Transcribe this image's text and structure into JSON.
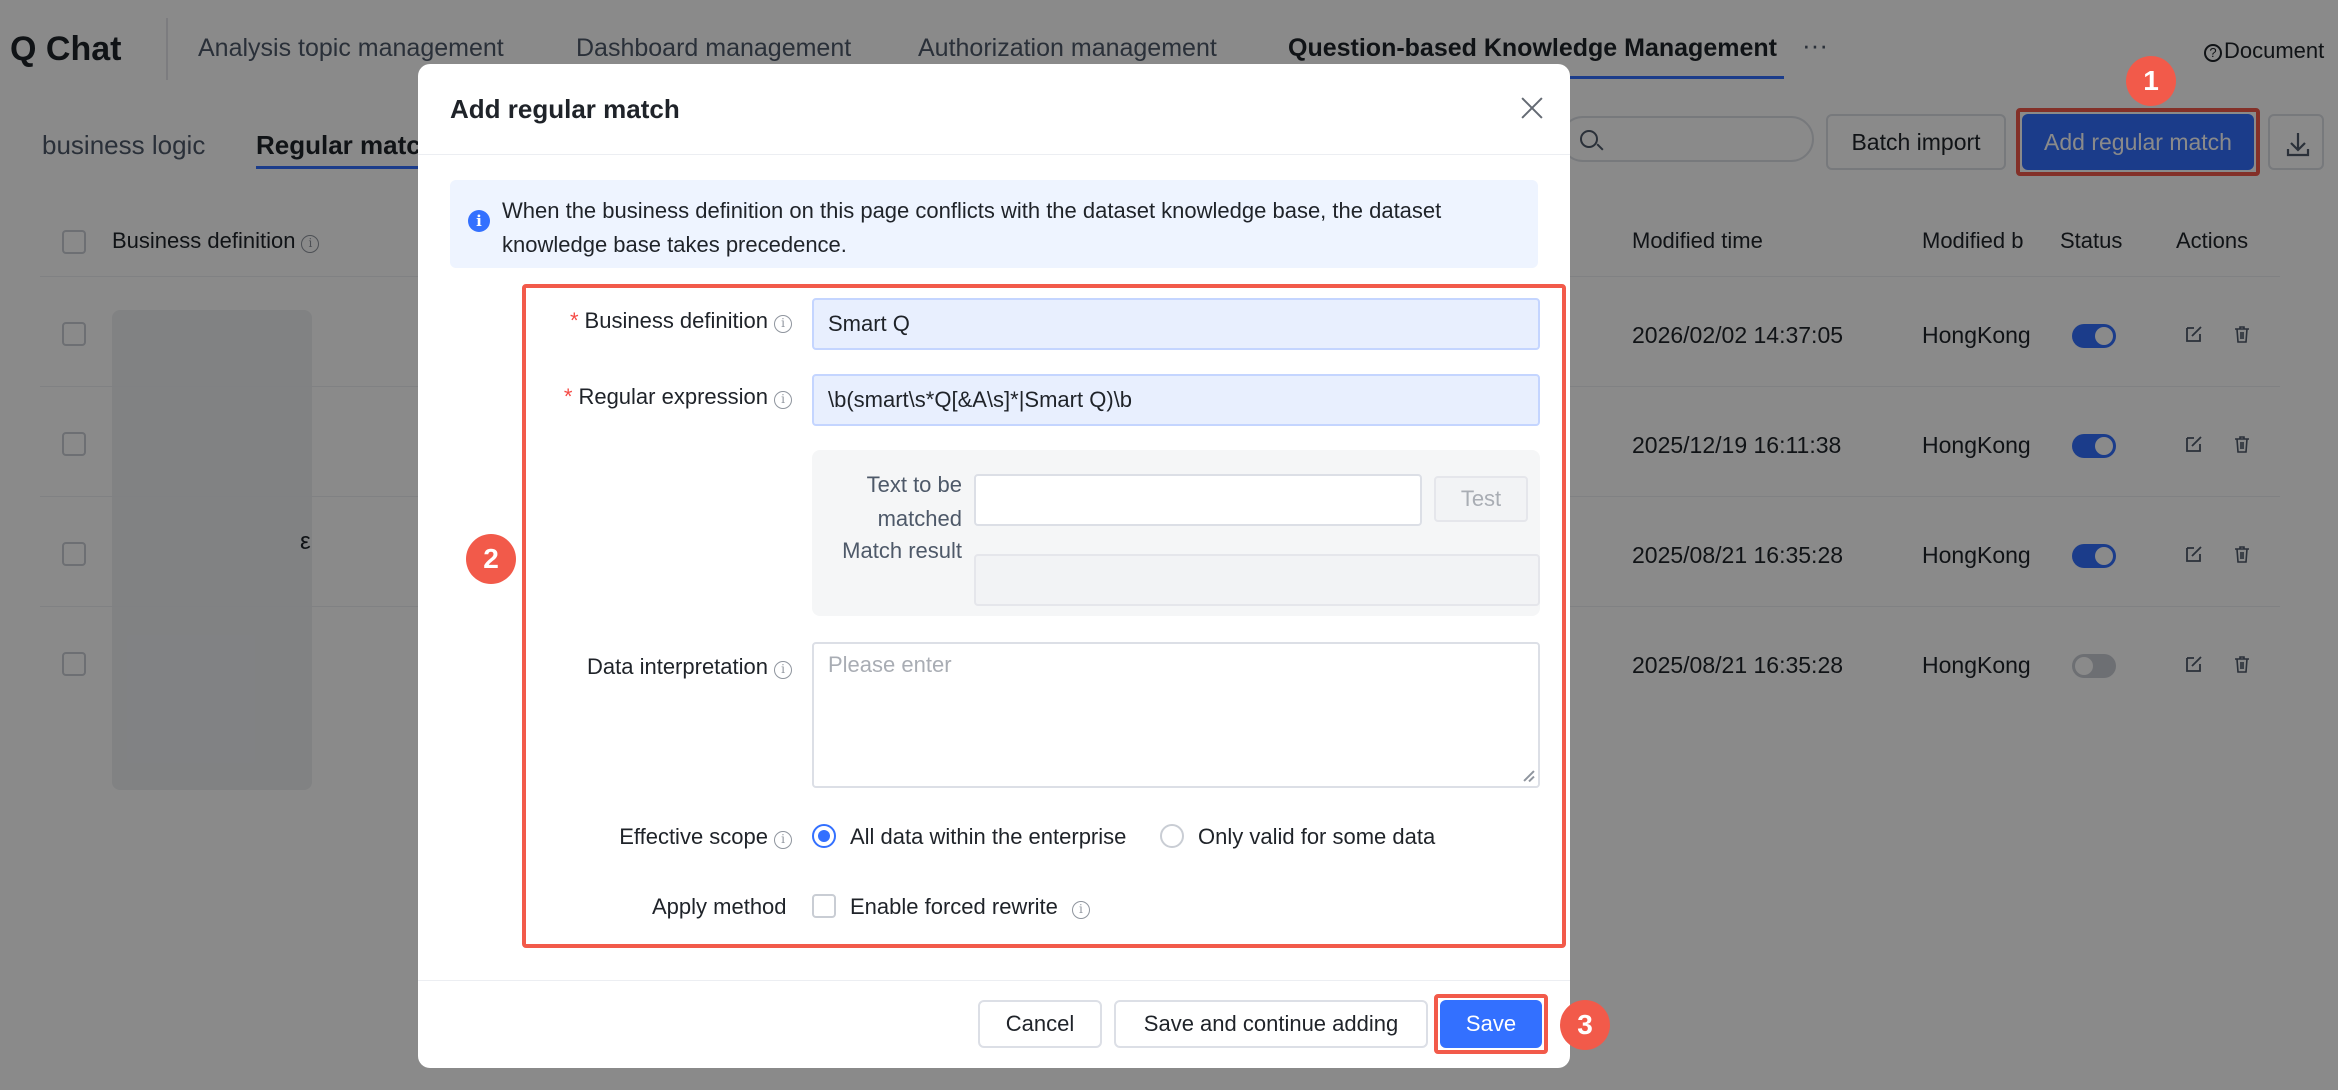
{
  "app": {
    "title": "Q Chat"
  },
  "nav": {
    "tabs": [
      {
        "label": "Analysis topic management"
      },
      {
        "label": "Dashboard management"
      },
      {
        "label": "Authorization management"
      },
      {
        "label": "Question-based Knowledge Management"
      }
    ],
    "active_index": 3,
    "more": "···",
    "document_link": "Document"
  },
  "subnav": {
    "tabs": [
      {
        "label": "business logic"
      },
      {
        "label": "Regular match"
      }
    ],
    "active_index": 1
  },
  "toolbar": {
    "batch_import": "Batch import",
    "add_regular_match": "Add regular match"
  },
  "table": {
    "columns": {
      "business_definition": "Business definition",
      "modified_time": "Modified time",
      "modified_by": "Modified b",
      "status": "Status",
      "actions": "Actions"
    },
    "rows": [
      {
        "modified_time": "2026/02/02 14:37:05",
        "modified_by": "HongKong",
        "status": "on"
      },
      {
        "modified_time": "2025/12/19 16:11:38",
        "modified_by": "HongKong",
        "status": "on"
      },
      {
        "modified_time": "2025/08/21 16:35:28",
        "modified_by": "HongKong",
        "status": "on"
      },
      {
        "modified_time": "2025/08/21 16:35:28",
        "modified_by": "HongKong",
        "status": "off"
      }
    ],
    "partial_text": "ε"
  },
  "modal": {
    "title": "Add regular match",
    "info": "When the business definition on this page conflicts with the dataset knowledge base, the dataset knowledge base takes precedence.",
    "fields": {
      "business_definition": {
        "label": "Business definition",
        "value": "Smart Q"
      },
      "regular_expression": {
        "label": "Regular expression",
        "value": "\\b(smart\\s*Q[&A\\s]*|Smart Q)\\b"
      },
      "text_to_be_matched": {
        "label": "Text to be matched",
        "value": ""
      },
      "test_button": "Test",
      "match_result": {
        "label": "Match result",
        "value": ""
      },
      "data_interpretation": {
        "label": "Data interpretation",
        "placeholder": "Please enter"
      },
      "effective_scope": {
        "label": "Effective scope",
        "options": [
          "All data within the enterprise",
          "Only valid for some data"
        ],
        "selected_index": 0
      },
      "apply_method": {
        "label": "Apply method",
        "option": "Enable forced rewrite",
        "checked": false
      }
    },
    "buttons": {
      "cancel": "Cancel",
      "save_continue": "Save and continue adding",
      "save": "Save"
    }
  },
  "annotations": [
    "1",
    "2",
    "3"
  ],
  "colors": {
    "primary": "#3370ff",
    "highlight": "#f25a4a",
    "required": "#f54a45"
  }
}
